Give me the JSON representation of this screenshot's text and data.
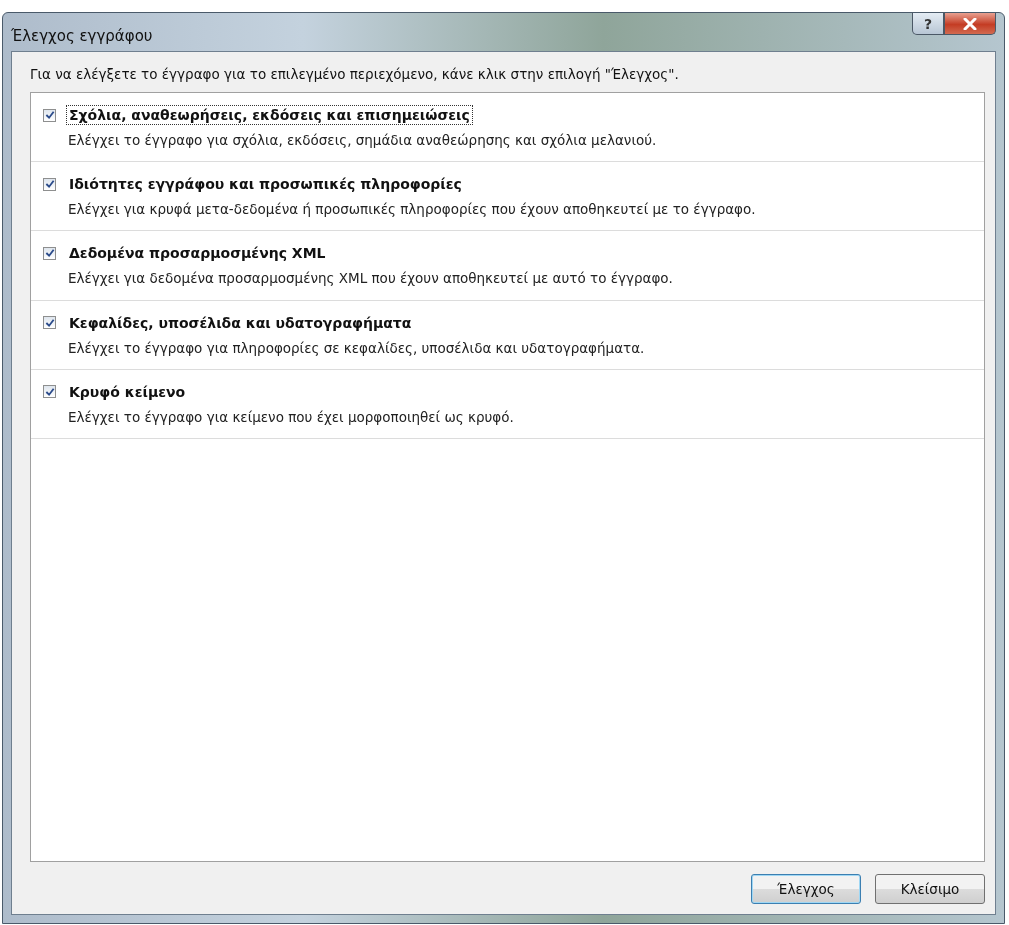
{
  "window": {
    "title": "Έλεγχος εγγράφου",
    "help_label": "?"
  },
  "instruction": "Για να ελέγξετε το έγγραφο για το επιλεγμένο περιεχόμενο, κάνε κλικ στην επιλογή \"Έλεγχος\".",
  "items": [
    {
      "title": "Σχόλια, αναθεωρήσεις, εκδόσεις και επισημειώσεις",
      "description": "Ελέγχει το έγγραφο για σχόλια, εκδόσεις, σημάδια αναθεώρησης και σχόλια μελανιού.",
      "checked": true,
      "focused": true
    },
    {
      "title": "Ιδιότητες εγγράφου και προσωπικές πληροφορίες",
      "description": "Ελέγχει για κρυφά μετα-δεδομένα ή προσωπικές πληροφορίες που έχουν αποθηκευτεί με το έγγραφο.",
      "checked": true,
      "focused": false
    },
    {
      "title": "Δεδομένα προσαρμοσμένης XML",
      "description": "Ελέγχει για δεδομένα προσαρμοσμένης XML που έχουν αποθηκευτεί με αυτό το έγγραφο.",
      "checked": true,
      "focused": false
    },
    {
      "title": "Κεφαλίδες, υποσέλιδα και υδατογραφήματα",
      "description": "Ελέγχει το έγγραφο για πληροφορίες σε κεφαλίδες, υποσέλιδα και υδατογραφήματα.",
      "checked": true,
      "focused": false
    },
    {
      "title": "Κρυφό κείμενο",
      "description": "Ελέγχει το έγγραφο για κείμενο που έχει μορφοποιηθεί ως κρυφό.",
      "checked": true,
      "focused": false
    }
  ],
  "buttons": [
    {
      "label": "Έλεγχος",
      "default": true
    },
    {
      "label": "Κλείσιμο",
      "default": false
    }
  ]
}
